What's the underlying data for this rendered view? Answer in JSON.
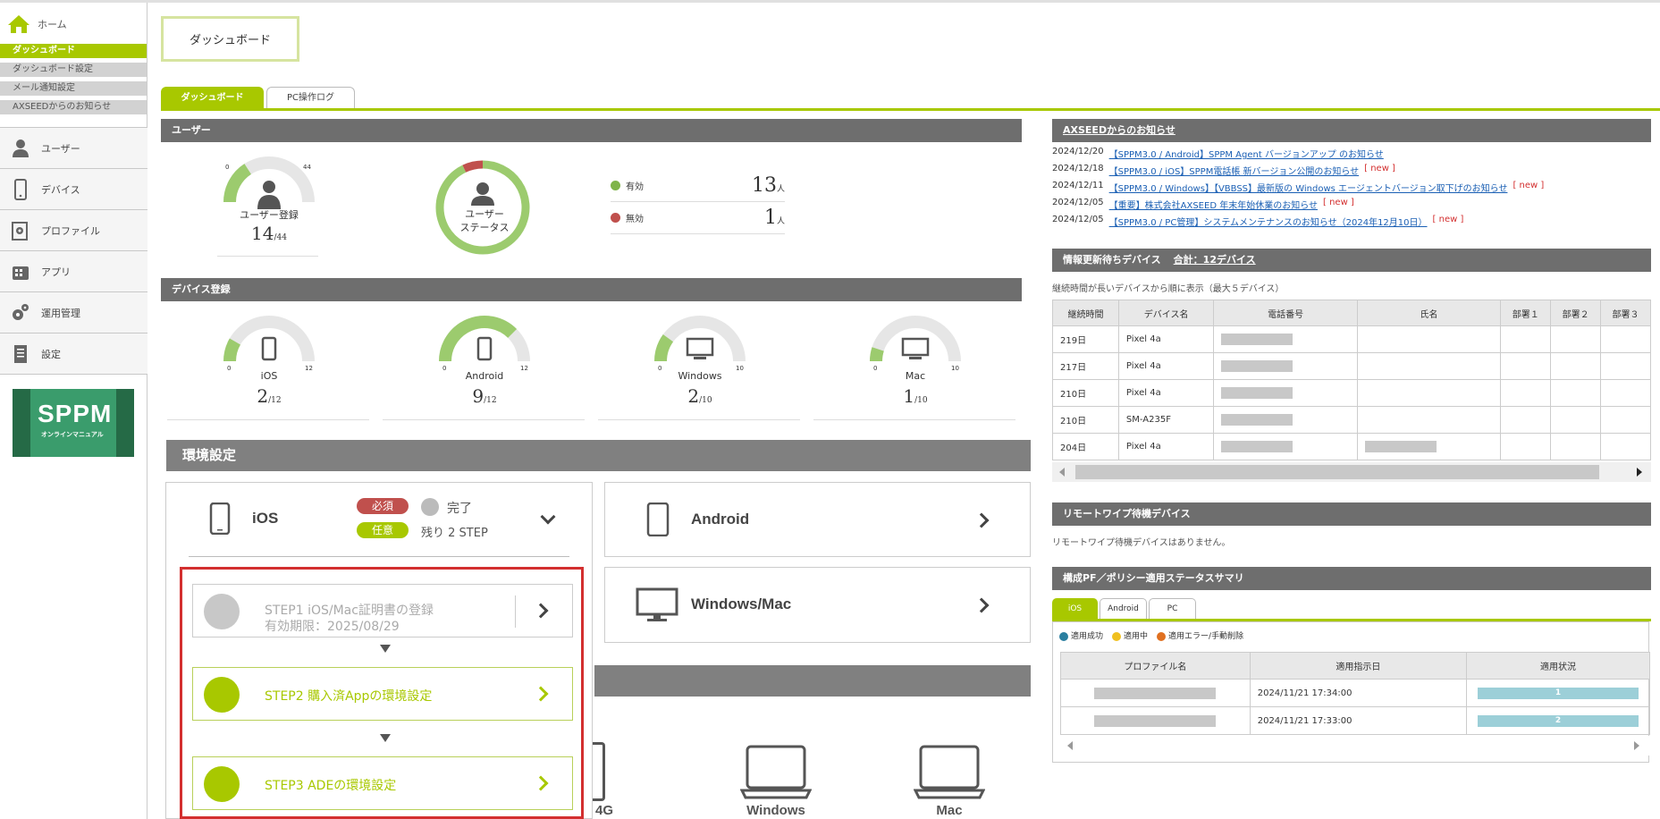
{
  "sidebar": {
    "home": "ホーム",
    "subnav": [
      "ダッシュボード",
      "ダッシュボード設定",
      "メール通知設定",
      "AXSEEDからのお知らせ"
    ],
    "mainnav": [
      "ユーザー",
      "デバイス",
      "プロファイル",
      "アプリ",
      "運用管理",
      "設定"
    ],
    "banner_title": "SPPM",
    "banner_sub": "オンラインマニュアル"
  },
  "page_title": "ダッシュボード",
  "tabs": [
    "ダッシュボード",
    "PC操作ログ"
  ],
  "user_section": {
    "title": "ユーザー",
    "registration": {
      "label": "ユーザー登録",
      "value": "14",
      "max": "44",
      "min_label": "0",
      "max_label": "44",
      "fraction": 0.318
    },
    "status_label": [
      "ユーザー",
      "ステータス"
    ],
    "status_fraction_valid": 0.929,
    "valid_label": "有効",
    "valid_value": "13",
    "unit": "人",
    "invalid_label": "無効",
    "invalid_value": "1",
    "valid_color": "#7fb44a",
    "invalid_color": "#c0504d"
  },
  "device_section": {
    "title": "デバイス登録",
    "devices": [
      {
        "name": "iOS",
        "value": "2",
        "max": "12",
        "min_label": "0",
        "max_label": "12",
        "fraction": 0.167
      },
      {
        "name": "Android",
        "value": "9",
        "max": "12",
        "min_label": "0",
        "max_label": "12",
        "fraction": 0.75
      },
      {
        "name": "Windows",
        "value": "2",
        "max": "10",
        "min_label": "0",
        "max_label": "10",
        "fraction": 0.2
      },
      {
        "name": "Mac",
        "value": "1",
        "max": "10",
        "min_label": "0",
        "max_label": "10",
        "fraction": 0.1
      }
    ]
  },
  "env": {
    "title": "環境設定",
    "ios": {
      "name": "iOS",
      "required": "必須",
      "done": "完了",
      "optional": "任意",
      "remaining": "残り 2 STEP"
    },
    "android": "Android",
    "winmac": "Windows/Mac",
    "steps": [
      {
        "line1": "STEP1 iOS/Mac証明書の登録",
        "line2": "有効期限：2025/08/29"
      },
      {
        "line1": "STEP2 購入済Appの環境設定"
      },
      {
        "line1": "STEP3 ADEの環境設定"
      }
    ],
    "bottom_labels": [
      "4G",
      "Windows",
      "Mac"
    ]
  },
  "news": {
    "title": "AXSEEDからのお知らせ",
    "items": [
      {
        "date": "2024/12/20",
        "text": "【SPPM3.0 / Android】SPPM Agent バージョンアップ のお知らせ",
        "new": ""
      },
      {
        "date": "2024/12/18",
        "text": "【SPPM3.0 / iOS】SPPM電話帳 新バージョン公開のお知らせ",
        "new": "[ new ]"
      },
      {
        "date": "2024/12/11",
        "text": "【SPPM3.0 / Windows】【VBBSS】最新版の Windows エージェントバージョン取下げのお知らせ",
        "new": "[ new ]"
      },
      {
        "date": "2024/12/05",
        "text": "【重要】株式会社AXSEED 年末年始休業のお知らせ",
        "new": "[ new ]"
      },
      {
        "date": "2024/12/05",
        "text": "【SPPM3.0 / PC管理】システムメンテナンスのお知らせ（2024年12月10日）",
        "new": "[ new ]"
      }
    ]
  },
  "pending": {
    "title": "情報更新待ちデバイス",
    "total": "合計：12デバイス",
    "note": "継続時間が長いデバイスから順に表示（最大５デバイス）",
    "headers": [
      "継続時間",
      "デバイス名",
      "電話番号",
      "氏名",
      "部署１",
      "部署２",
      "部署３"
    ],
    "rows": [
      {
        "days": "219日",
        "device": "Pixel 4a"
      },
      {
        "days": "217日",
        "device": "Pixel 4a"
      },
      {
        "days": "210日",
        "device": "Pixel 4a"
      },
      {
        "days": "210日",
        "device": "SM-A235F"
      },
      {
        "days": "204日",
        "device": "Pixel 4a"
      }
    ]
  },
  "wipe": {
    "title": "リモートワイプ待機デバイス",
    "note": "リモートワイプ待機デバイスはありません。"
  },
  "policy": {
    "title": "構成PF／ポリシー適用ステータスサマリ",
    "tabs": [
      "iOS",
      "Android",
      "PC"
    ],
    "legend": [
      "適用成功",
      "適用中",
      "適用エラー/手動削除"
    ],
    "headers": [
      "プロファイル名",
      "適用指示日",
      "適用状況"
    ],
    "rows": [
      {
        "date": "2024/11/21 17:34:00",
        "count": "1"
      },
      {
        "date": "2024/11/21 17:33:00",
        "count": "2"
      }
    ]
  },
  "colors": {
    "accent": "#a8c800",
    "header": "#6e6e6e",
    "gauge": "#9ccb6e"
  }
}
